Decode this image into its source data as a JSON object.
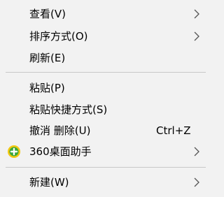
{
  "context_menu": {
    "items": [
      {
        "label": "查看(V)",
        "icon": "chevron-right-icon"
      },
      {
        "label": "排序方式(O)",
        "icon": "chevron-right-icon"
      },
      {
        "label": "刷新(E)"
      },
      {
        "label": "粘贴(P)"
      },
      {
        "label": "粘贴快捷方式(S)"
      },
      {
        "label": "撤消 删除(U)",
        "shortcut": "Ctrl+Z"
      },
      {
        "label": "360桌面助手",
        "icon": "360-assistant-icon",
        "submenu_icon": "chevron-right-icon"
      },
      {
        "label": "新建(W)",
        "icon": "chevron-right-icon"
      }
    ]
  },
  "colors": {
    "menu_bg": "#f2f2f2",
    "separator": "#c8c8c8",
    "chevron": "#555555",
    "icon_green": "#3aa83a",
    "icon_yellow": "#f2c811"
  }
}
